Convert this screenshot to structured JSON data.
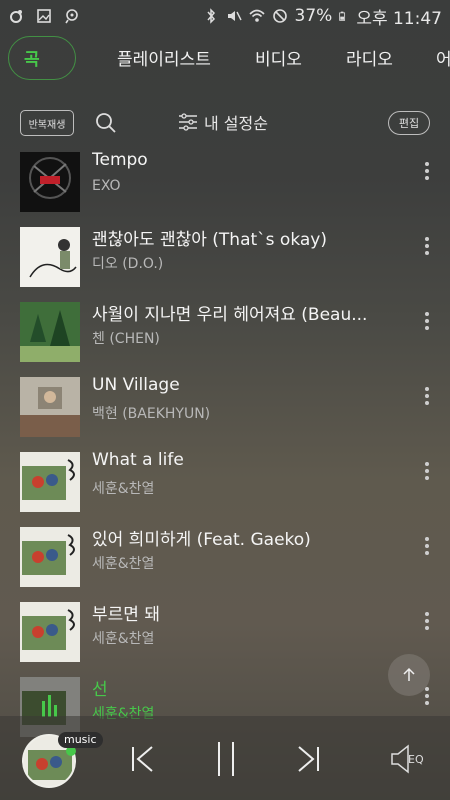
{
  "status_bar": {
    "battery": "37%",
    "time": "오후 11:47"
  },
  "tabs": [
    {
      "label": "곡"
    },
    {
      "label": "플레이리스트"
    },
    {
      "label": "비디오"
    },
    {
      "label": "라디오"
    },
    {
      "label": "어"
    }
  ],
  "toolbar": {
    "repeat_label": "반복재생",
    "sort_label": "내 설정순",
    "edit_label": "편집"
  },
  "songs": [
    {
      "title": "Tempo",
      "artist": "EXO"
    },
    {
      "title": "괜찮아도 괜찮아 (That`s okay)",
      "artist": "디오 (D.O.)"
    },
    {
      "title": "사월이 지나면 우리 헤어져요 (Beau...",
      "artist": "첸 (CHEN)"
    },
    {
      "title": "UN Village",
      "artist": "백현 (BAEKHYUN)"
    },
    {
      "title": "What a life",
      "artist": "세훈&찬열"
    },
    {
      "title": "있어 희미하게 (Feat. Gaeko)",
      "artist": "세훈&찬열"
    },
    {
      "title": "부르면 돼",
      "artist": "세훈&찬열"
    },
    {
      "title": "선",
      "artist": "세훈&찬열",
      "playing": true
    }
  ],
  "player": {
    "badge": "music",
    "eq_label": "EQ"
  },
  "colors": {
    "accent": "#47c84a"
  }
}
